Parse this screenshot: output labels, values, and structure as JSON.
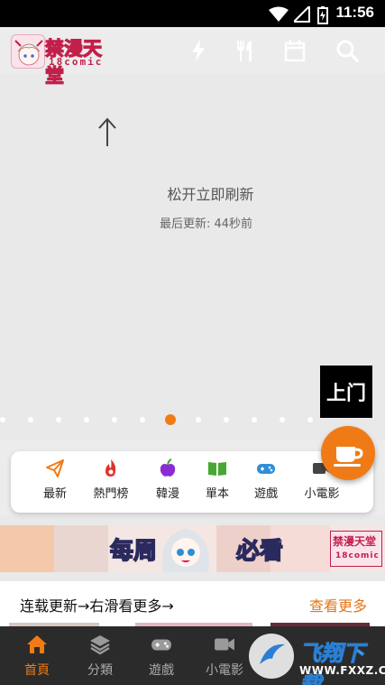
{
  "status_bar": {
    "time": "11:56",
    "icons": [
      "wifi-icon",
      "signal-icon",
      "battery-icon"
    ]
  },
  "app_bar": {
    "logo_text": "禁漫天堂",
    "logo_sub": "18comic",
    "actions": [
      "lightning-icon",
      "fork-knife-icon",
      "calendar-icon",
      "search-icon"
    ]
  },
  "refresh": {
    "title": "松开立即刷新",
    "updated": "最后更新: 44秒前"
  },
  "up_button": "上门",
  "carousel": {
    "dot_count": 12,
    "active_index": 6
  },
  "categories": [
    {
      "label": "最新",
      "icon": "paper-plane-icon",
      "color": "#f07b16"
    },
    {
      "label": "熱門榜",
      "icon": "flame-icon",
      "color": "#e0312d"
    },
    {
      "label": "韓漫",
      "icon": "apple-icon",
      "color": "#8b2bd3"
    },
    {
      "label": "單本",
      "icon": "open-book-icon",
      "color": "#46a832"
    },
    {
      "label": "遊戲",
      "icon": "gamepad-icon",
      "color": "#2f8fd8"
    },
    {
      "label": "小電影",
      "icon": "video-icon",
      "color": "#444444"
    }
  ],
  "banner": {
    "text_left": "每周",
    "text_right": "必看",
    "logo_text": "禁漫天堂",
    "logo_sub": "18comic"
  },
  "section": {
    "title": "连载更新→右滑看更多→",
    "more": "查看更多"
  },
  "bottom_nav": [
    {
      "label": "首頁",
      "icon": "home-icon",
      "active": true
    },
    {
      "label": "分類",
      "icon": "layers-icon",
      "active": false
    },
    {
      "label": "遊戲",
      "icon": "gamepad-icon",
      "active": false
    },
    {
      "label": "小電影",
      "icon": "video-icon",
      "active": false
    }
  ],
  "watermark": {
    "title": "飞翔下载",
    "url": "WWW.FXXZ.COM"
  },
  "colors": {
    "accent": "#f07b16",
    "brand": "#c21f4a",
    "nav_bg": "#2b2b2b"
  }
}
